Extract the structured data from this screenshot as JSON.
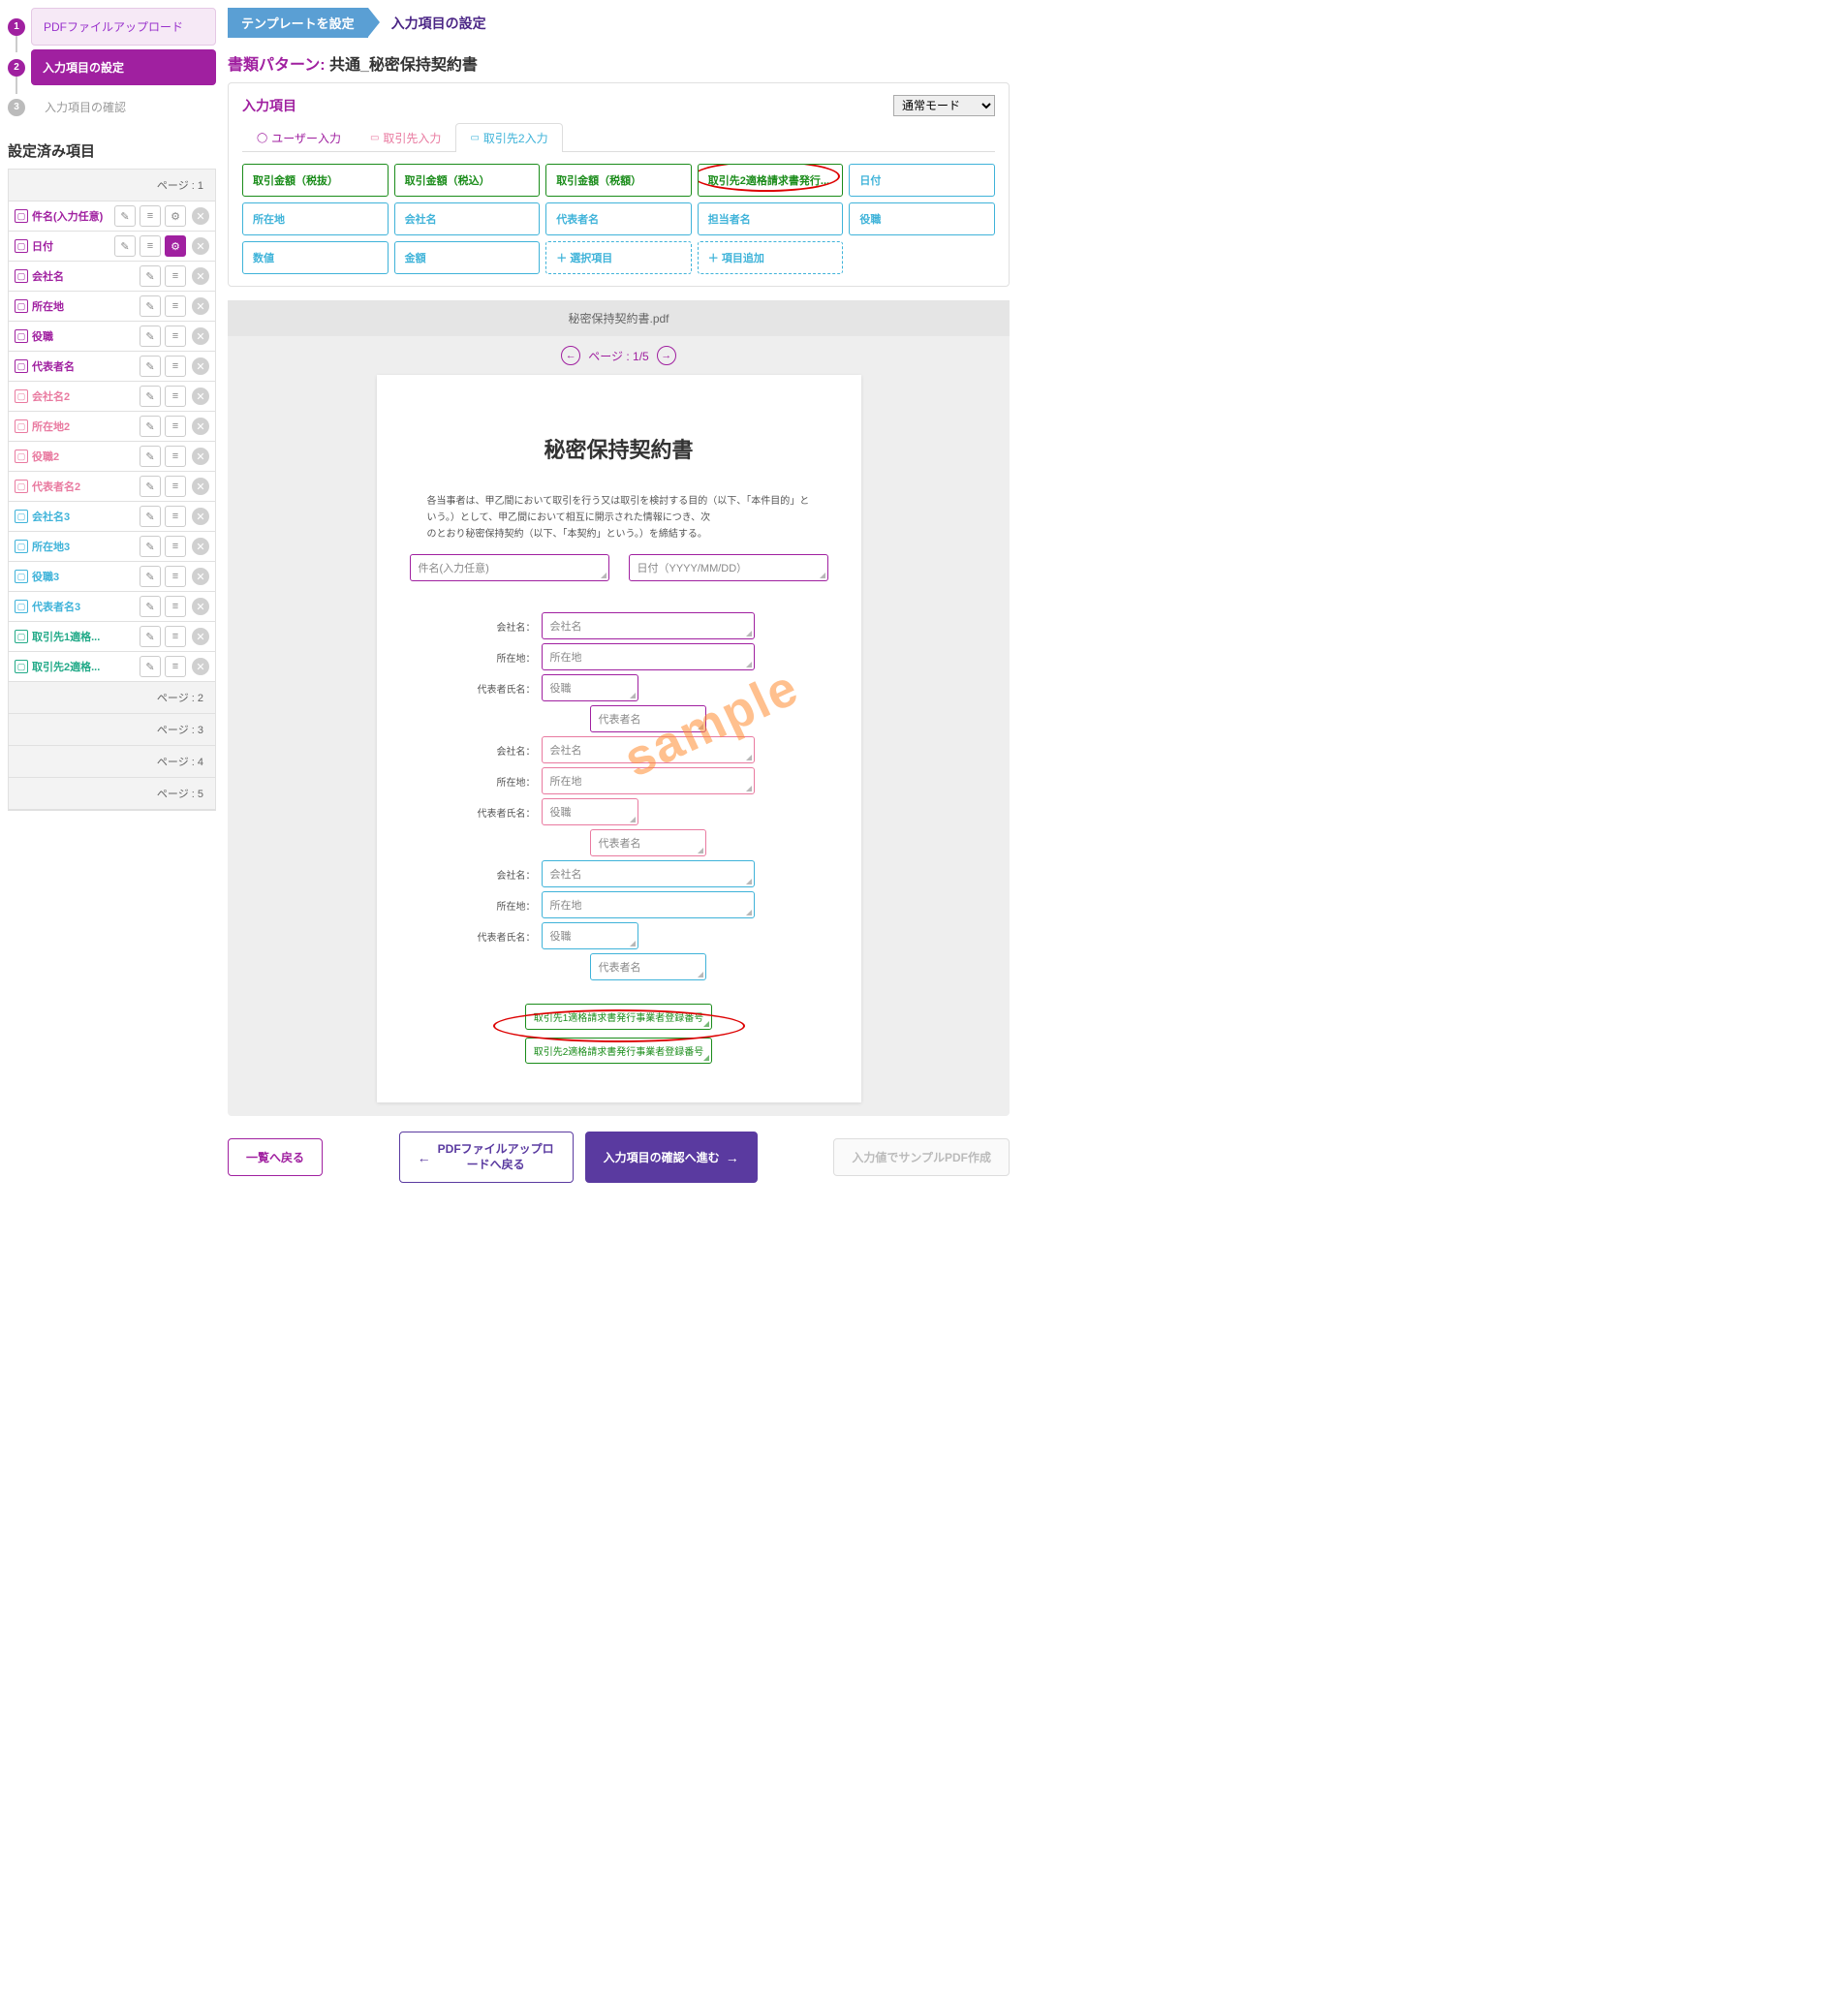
{
  "stepper": [
    {
      "num": "1",
      "label": "PDFファイルアップロード",
      "style": "light",
      "dot": "purple"
    },
    {
      "num": "2",
      "label": "入力項目の設定",
      "style": "active",
      "dot": "purple"
    },
    {
      "num": "3",
      "label": "入力項目の確認",
      "style": "plain",
      "dot": "gray"
    }
  ],
  "sidebar": {
    "title": "設定済み項目",
    "pages": [
      "ページ : 1",
      "ページ : 2",
      "ページ : 3",
      "ページ : 4",
      "ページ : 5"
    ],
    "items": [
      {
        "label": "件名(入力任意)",
        "color": "purple",
        "gear": true,
        "gearFilled": false
      },
      {
        "label": "日付",
        "color": "purple",
        "gear": true,
        "gearFilled": true
      },
      {
        "label": "会社名",
        "color": "purple"
      },
      {
        "label": "所在地",
        "color": "purple"
      },
      {
        "label": "役職",
        "color": "purple"
      },
      {
        "label": "代表者名",
        "color": "purple"
      },
      {
        "label": "会社名2",
        "color": "pink"
      },
      {
        "label": "所在地2",
        "color": "pink"
      },
      {
        "label": "役職2",
        "color": "pink"
      },
      {
        "label": "代表者名2",
        "color": "pink"
      },
      {
        "label": "会社名3",
        "color": "cyan"
      },
      {
        "label": "所在地3",
        "color": "cyan"
      },
      {
        "label": "役職3",
        "color": "cyan"
      },
      {
        "label": "代表者名3",
        "color": "cyan"
      },
      {
        "label": "取引先1適格...",
        "color": "green"
      },
      {
        "label": "取引先2適格...",
        "color": "green"
      }
    ]
  },
  "breadcrumb": {
    "step1": "テンプレートを設定",
    "step2": "入力項目の設定"
  },
  "pattern": {
    "label": "書類パターン:",
    "value": "共通_秘密保持契約書"
  },
  "panel": {
    "heading": "入力項目",
    "mode": "通常モード",
    "tabs": [
      {
        "icon": "person",
        "label": "ユーザー入力",
        "color": "purple"
      },
      {
        "icon": "doc",
        "label": "取引先入力",
        "color": "pink"
      },
      {
        "icon": "doc",
        "label": "取引先2入力",
        "color": "cyan",
        "active": true
      }
    ],
    "fields": [
      {
        "label": "取引金額（税抜）",
        "style": "green"
      },
      {
        "label": "取引金額（税込）",
        "style": "green"
      },
      {
        "label": "取引金額（税額）",
        "style": "green"
      },
      {
        "label": "取引先2適格請求書発行...",
        "style": "green",
        "ring": true
      },
      {
        "label": "日付",
        "style": "cyan"
      },
      {
        "label": "所在地",
        "style": "cyan"
      },
      {
        "label": "会社名",
        "style": "cyan"
      },
      {
        "label": "代表者名",
        "style": "cyan"
      },
      {
        "label": "担当者名",
        "style": "cyan"
      },
      {
        "label": "役職",
        "style": "cyan"
      },
      {
        "label": "数値",
        "style": "cyan"
      },
      {
        "label": "金額",
        "style": "cyan"
      },
      {
        "label": "＋ 選択項目",
        "style": "cyan-dashed"
      },
      {
        "label": "＋ 項目追加",
        "style": "cyan-dashed"
      }
    ]
  },
  "preview": {
    "filename": "秘密保持契約書.pdf",
    "page": "ページ : 1/5",
    "doc": {
      "title": "秘密保持契約書",
      "body1": "各当事者は、甲乙間において取引を行う又は取引を検討する目的（以下、「本件目的」という。）として、甲乙間において相互に開示された情報につき、次",
      "body2": "のとおり秘密保持契約（以下、「本契約」という。）を締結する。",
      "f_subject": "件名(入力任意)",
      "f_date": "日付（YYYY/MM/DD）",
      "lbls": {
        "company": "会社名：",
        "address": "所在地：",
        "repname": "代表者氏名："
      },
      "ph": {
        "company": "会社名",
        "address": "所在地",
        "role": "役職",
        "rep": "代表者名"
      },
      "g1": "取引先1適格請求書発行事業者登録番号",
      "g2": "取引先2適格請求書発行事業者登録番号",
      "stamp": "sample"
    }
  },
  "footer": {
    "back": "一覧へ戻る",
    "upload": "PDFファイルアップロードへ戻る",
    "next": "入力項目の確認へ進む",
    "sample": "入力値でサンプルPDF作成"
  }
}
